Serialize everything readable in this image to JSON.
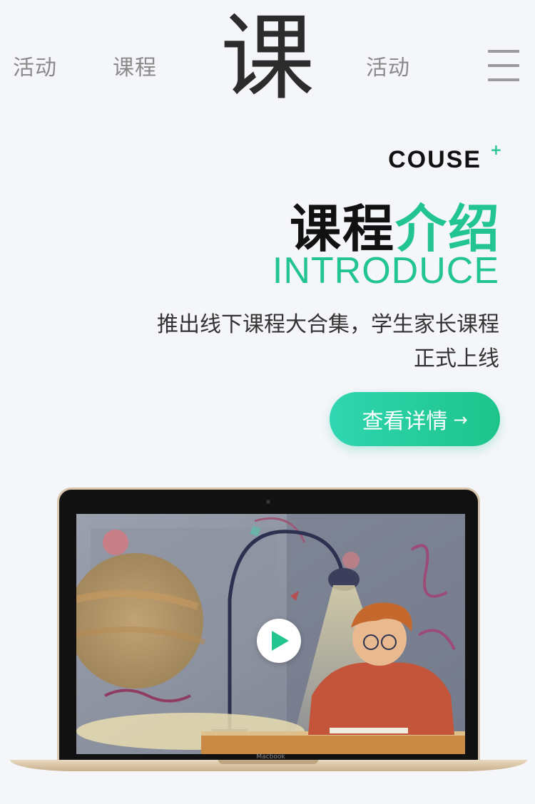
{
  "nav": {
    "links": [
      "活动",
      "课程",
      "活动"
    ],
    "logo_char": "课",
    "menu_icon": "hamburger-menu-icon"
  },
  "intro": {
    "eyebrow": "COUSE",
    "eyebrow_mark": "+",
    "headline_dark": "课程",
    "headline_accent": "介绍",
    "subtitle_en": "INTRODUCE",
    "desc_line1": "推出线下课程大合集，学生家长课程",
    "desc_line2": "正式上线",
    "cta_label": "查看详情",
    "cta_arrow": "→"
  },
  "laptop": {
    "brand": "Macbook",
    "play_icon": "play-icon"
  },
  "colors": {
    "accent": "#22c48f",
    "background": "#f5f6fa",
    "nav_text": "#8a8a8a"
  }
}
